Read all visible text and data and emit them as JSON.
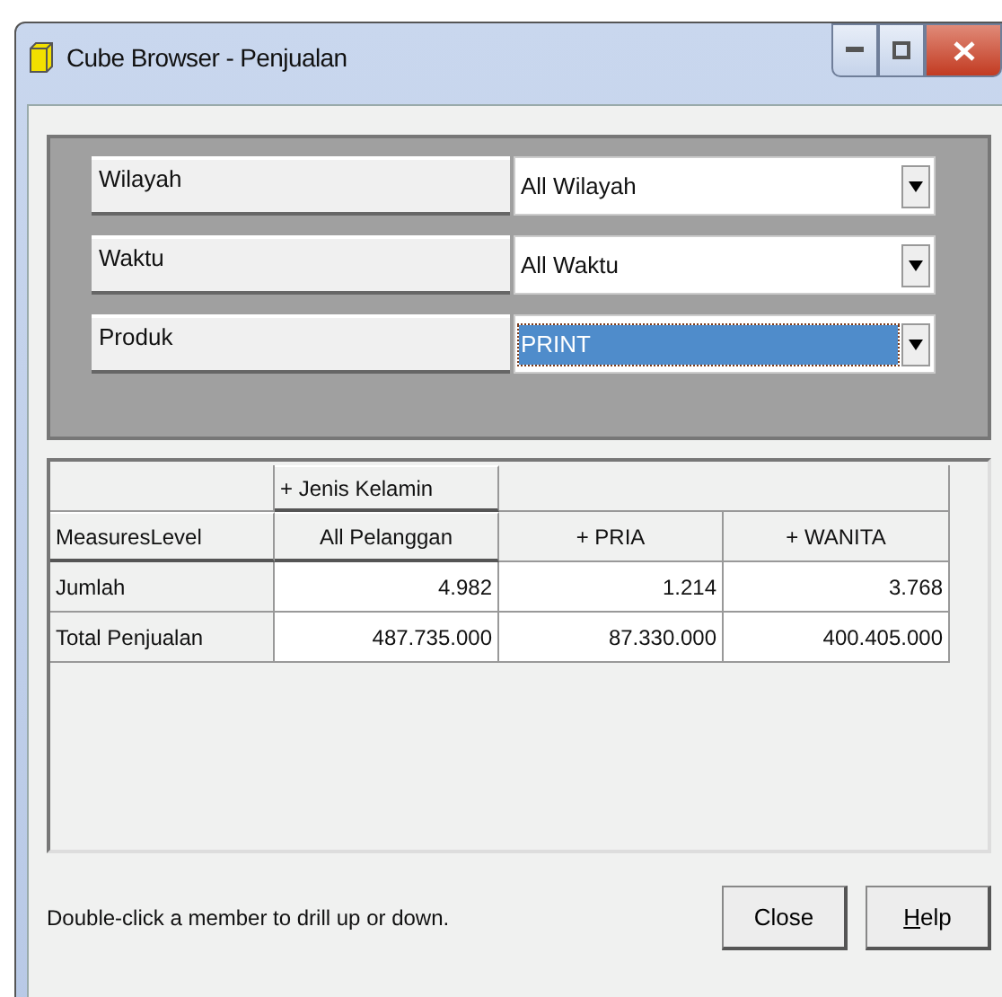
{
  "window": {
    "title": "Cube Browser - Penjualan"
  },
  "filters": [
    {
      "label": "Wilayah",
      "value": "All Wilayah",
      "focused": false
    },
    {
      "label": "Waktu",
      "value": "All Waktu",
      "focused": false
    },
    {
      "label": "Produk",
      "value": "PRINT",
      "focused": true
    }
  ],
  "pivot": {
    "column_dimension": "+ Jenis Kelamin",
    "row_header": "MeasuresLevel",
    "columns": [
      "All Pelanggan",
      "+  PRIA",
      "+  WANITA"
    ],
    "rows": [
      {
        "label": "Jumlah",
        "values": [
          "4.982",
          "1.214",
          "3.768"
        ]
      },
      {
        "label": "Total Penjualan",
        "values": [
          "487.735.000",
          "87.330.000",
          "400.405.000"
        ]
      }
    ]
  },
  "status_text": "Double-click a member to drill up or down.",
  "buttons": [
    "Close",
    "Help"
  ]
}
